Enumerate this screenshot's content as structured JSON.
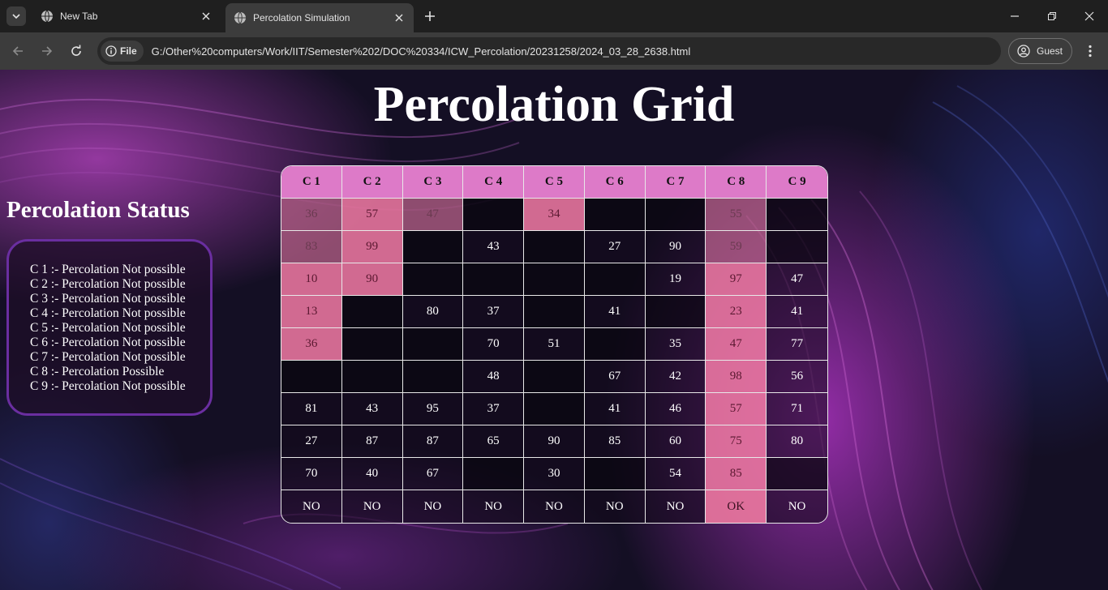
{
  "browser": {
    "tabs": [
      {
        "title": "New Tab",
        "active": false
      },
      {
        "title": "Percolation Simulation",
        "active": true
      }
    ],
    "url_chip": "File",
    "url": "G:/Other%20computers/Work/IIT/Semester%202/DOC%20334/ICW_Percolation/20231258/2024_03_28_2638.html",
    "profile_label": "Guest"
  },
  "page": {
    "title": "Percolation Grid",
    "status_heading": "Percolation Status",
    "status_lines": [
      "C 1 :- Percolation Not possible",
      "C 2 :- Percolation Not possible",
      "C 3 :- Percolation Not possible",
      "C 4 :- Percolation Not possible",
      "C 5 :- Percolation Not possible",
      "C 6 :- Percolation Not possible",
      "C 7 :- Percolation Not possible",
      "C 8 :- Percolation Possible",
      "C 9 :- Percolation Not possible"
    ],
    "grid": {
      "headers": [
        "C 1",
        "C 2",
        "C 3",
        "C 4",
        "C 5",
        "C 6",
        "C 7",
        "C 8",
        "C 9"
      ],
      "rows": [
        [
          "36",
          "57",
          "47",
          "",
          "34",
          "",
          "",
          "55",
          ""
        ],
        [
          "83",
          "99",
          "",
          "43",
          "",
          "27",
          "90",
          "59",
          ""
        ],
        [
          "10",
          "90",
          "",
          "",
          "",
          "",
          "19",
          "97",
          "47"
        ],
        [
          "13",
          "",
          "80",
          "37",
          "",
          "41",
          "",
          "23",
          "41"
        ],
        [
          "36",
          "",
          "",
          "70",
          "51",
          "",
          "35",
          "47",
          "77"
        ],
        [
          "",
          "",
          "",
          "48",
          "",
          "67",
          "42",
          "98",
          "56"
        ],
        [
          "81",
          "43",
          "95",
          "37",
          "",
          "41",
          "46",
          "57",
          "71"
        ],
        [
          "27",
          "87",
          "87",
          "65",
          "90",
          "85",
          "60",
          "75",
          "80"
        ],
        [
          "70",
          "40",
          "67",
          "",
          "30",
          "",
          "54",
          "85",
          ""
        ]
      ],
      "open_cells": [
        [
          1,
          1,
          1,
          0,
          1,
          0,
          0,
          1,
          0
        ],
        [
          1,
          1,
          0,
          0,
          0,
          0,
          0,
          1,
          0
        ],
        [
          1,
          1,
          0,
          0,
          0,
          0,
          0,
          1,
          0
        ],
        [
          1,
          0,
          0,
          0,
          0,
          0,
          0,
          1,
          0
        ],
        [
          1,
          0,
          0,
          0,
          0,
          0,
          0,
          1,
          0
        ],
        [
          0,
          0,
          0,
          0,
          0,
          0,
          0,
          1,
          0
        ],
        [
          0,
          0,
          0,
          0,
          0,
          0,
          0,
          1,
          0
        ],
        [
          0,
          0,
          0,
          0,
          0,
          0,
          0,
          1,
          0
        ],
        [
          0,
          0,
          0,
          0,
          0,
          0,
          0,
          1,
          0
        ]
      ],
      "result_row": [
        "NO",
        "NO",
        "NO",
        "NO",
        "NO",
        "NO",
        "NO",
        "OK",
        "NO"
      ]
    }
  },
  "colors": {
    "header_pink": "#dd7ac8",
    "open_cell": "#ec78a0",
    "status_border": "#6a2ea0"
  }
}
